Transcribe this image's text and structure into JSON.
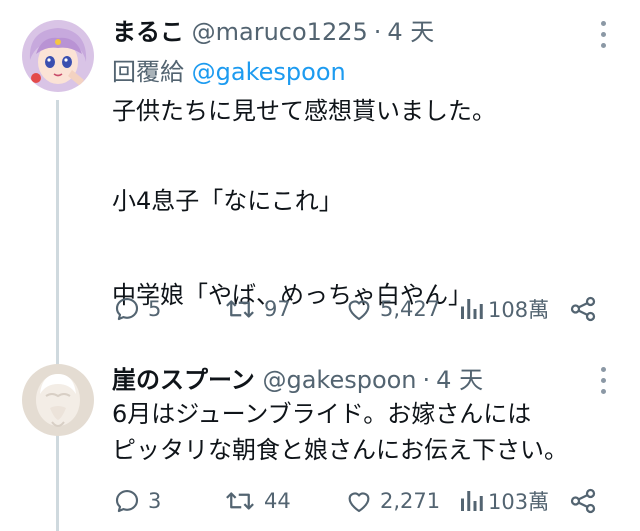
{
  "tweets": [
    {
      "name": "まるこ",
      "handle": "@maruco1225",
      "separator": "·",
      "time": "4 天",
      "reply_prefix": "回覆給",
      "reply_mention": "@gakespoon",
      "lines": [
        "子供たちに見せて感想貰いました。",
        "",
        "小4息子「なにこれ」",
        "",
        "中学娘「やば、めっちゃ白やん」"
      ],
      "stats": {
        "replies": "5",
        "retweets": "97",
        "likes": "5,427",
        "views": "108萬"
      },
      "avatar_icon": "anime-character-avatar"
    },
    {
      "name": "崖のスプーン",
      "handle": "@gakespoon",
      "separator": "·",
      "time": "4 天",
      "lines": [
        "6月はジューンブライド。お嫁さんには",
        "ピッタリな朝食と娘さんにお伝え下さい。"
      ],
      "stats": {
        "replies": "3",
        "retweets": "44",
        "likes": "2,271",
        "views": "103萬"
      },
      "avatar_icon": "white-sculpture-avatar"
    }
  ],
  "colors": {
    "text": "#0f1419",
    "secondary": "#536471",
    "link": "#1d9bf0",
    "thread_line": "#cfd9de"
  }
}
